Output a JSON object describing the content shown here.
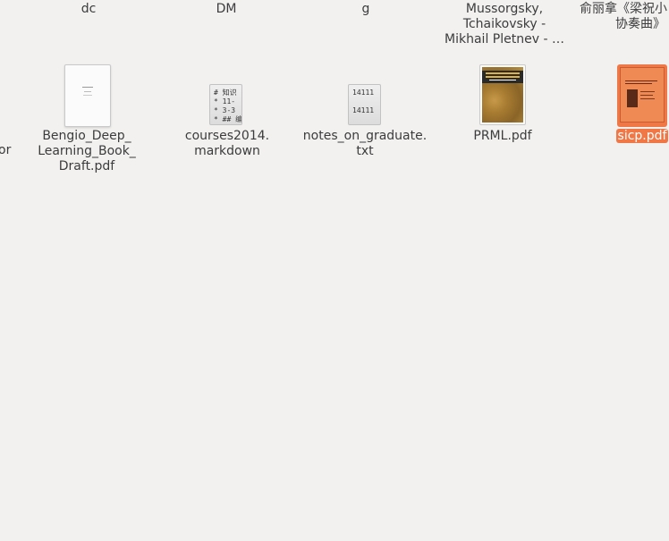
{
  "folders_top": [
    {
      "name": "dc"
    },
    {
      "name": "DM"
    },
    {
      "name": "g"
    },
    {
      "name_lines": [
        "Mussorgsky,",
        "Tchaikovsky -",
        "Mikhail Pletnev - …"
      ]
    },
    {
      "name_lines": [
        "俞丽拿《梁祝小",
        "协奏曲》"
      ]
    }
  ],
  "partial_left_label": "or",
  "files": [
    {
      "name_lines": [
        "Bengio_Deep_",
        "Learning_Book_",
        "Draft.pdf"
      ],
      "icon": "pdf-thumbnail-icon"
    },
    {
      "name_lines": [
        "courses2014.",
        "markdown"
      ],
      "icon": "markdown-file-icon",
      "preview": "# 知识\n* 11-\n* 3-3\n* ## 编"
    },
    {
      "name_lines": [
        "notes_on_graduate.",
        "txt"
      ],
      "icon": "text-file-icon",
      "preview": "14111\n\n14111"
    },
    {
      "name": "PRML.pdf",
      "icon": "prml-cover-icon",
      "cover_title": "PATTERN RECOGNITION AND MACHINE LEARNING",
      "cover_author": "CHRISTOPHER M. BISHOP"
    },
    {
      "name": "sicp.pdf",
      "icon": "sicp-cover-icon",
      "selected": true,
      "cover_title": "Structure and Interpretation of Computer Programs"
    }
  ],
  "colors": {
    "background": "#f2f1f0",
    "selection": "#f07746",
    "text": "#3c3c3c"
  }
}
